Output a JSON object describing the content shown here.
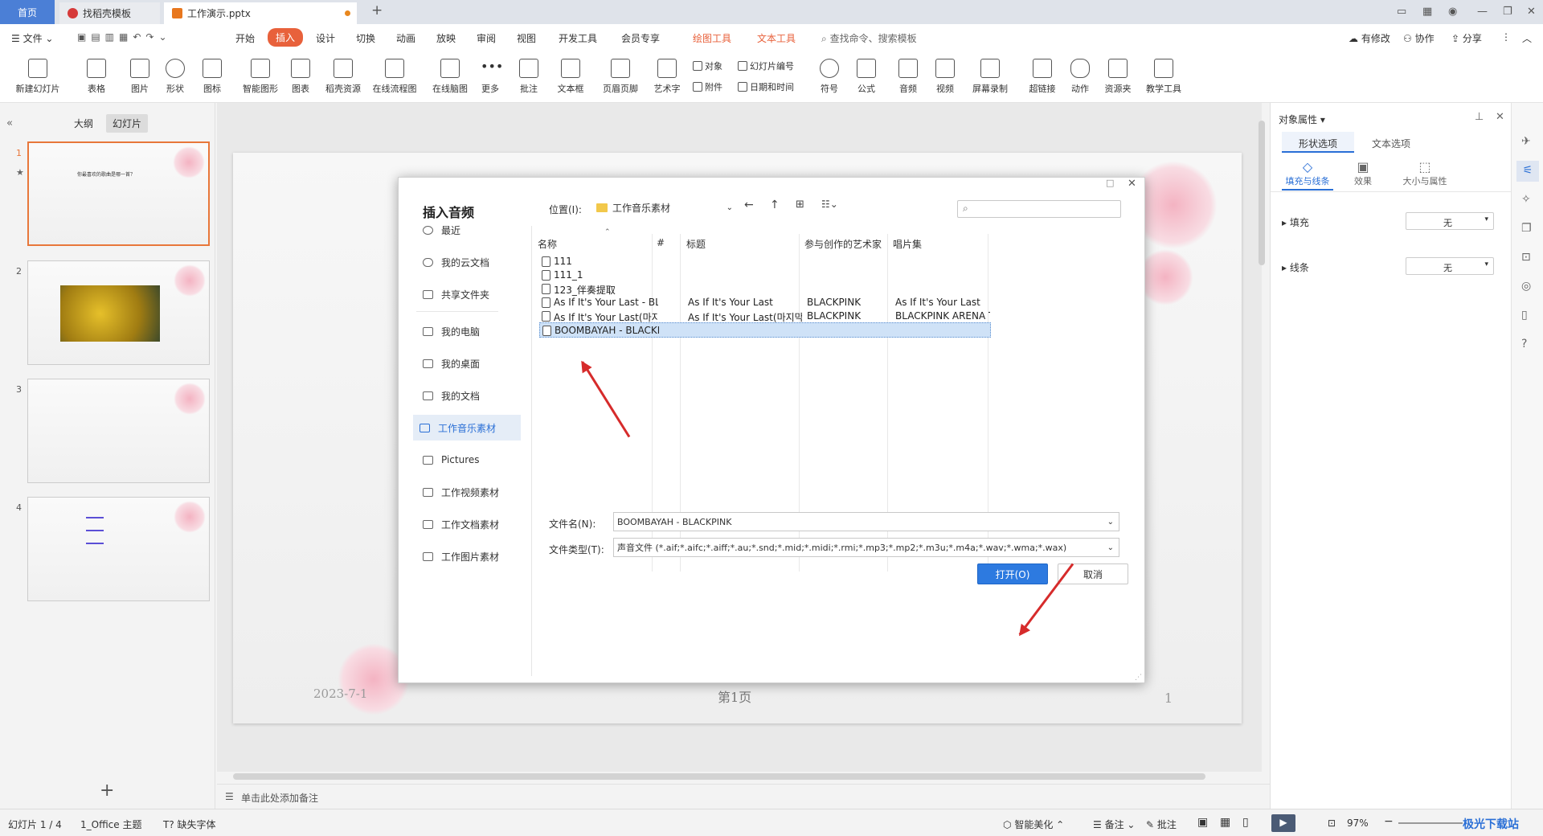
{
  "tabs": {
    "home": "首页",
    "template": "找稻壳模板",
    "doc": "工作演示.pptx"
  },
  "menubar": {
    "file": "文件",
    "items": [
      "开始",
      "插入",
      "设计",
      "切换",
      "动画",
      "放映",
      "审阅",
      "视图",
      "开发工具",
      "会员专享"
    ],
    "context_tools": [
      "绘图工具",
      "文本工具"
    ],
    "search": "查找命令、搜索模板",
    "right": [
      "有修改",
      "协作",
      "分享"
    ]
  },
  "ribbon": {
    "buttons": [
      "新建幻灯片",
      "表格",
      "图片",
      "形状",
      "图标",
      "智能图形",
      "图表",
      "稻壳资源",
      "在线流程图",
      "在线脑图",
      "更多",
      "批注",
      "文本框",
      "页眉页脚",
      "艺术字",
      "音频",
      "视频",
      "屏幕录制",
      "超链接",
      "动作",
      "资源夹",
      "教学工具"
    ],
    "small": [
      "对象",
      "幻灯片编号",
      "附件",
      "日期和时间",
      "符号",
      "公式"
    ]
  },
  "left_panel": {
    "tabs": [
      "大纲",
      "幻灯片"
    ],
    "slide_numbers": [
      "1",
      "2",
      "3",
      "4"
    ],
    "slide1_title": "你最喜欢的歌曲是哪一首？",
    "add": "+"
  },
  "slide": {
    "date": "2023-7-1",
    "footer": "第1页",
    "page_num": "1"
  },
  "right_panel": {
    "title": "对象属性",
    "tabs": [
      "形状选项",
      "文本选项"
    ],
    "subtabs": [
      "填充与线条",
      "效果",
      "大小与属性"
    ],
    "fill_label": "填充",
    "fill_value": "无",
    "line_label": "线条",
    "line_value": "无"
  },
  "dialog": {
    "title": "插入音频",
    "location_label": "位置(I):",
    "location_value": "工作音乐素材",
    "nav": [
      "最近",
      "我的云文档",
      "共享文件夹",
      "我的电脑",
      "我的桌面",
      "我的文档",
      "工作音乐素材",
      "Pictures",
      "工作视频素材",
      "工作文档素材",
      "工作图片素材"
    ],
    "columns": [
      "名称",
      "#",
      "标题",
      "参与创作的艺术家",
      "唱片集"
    ],
    "files": [
      {
        "name": "111",
        "title": "",
        "artist": "",
        "album": ""
      },
      {
        "name": "111_1",
        "title": "",
        "artist": "",
        "album": ""
      },
      {
        "name": "123_伴奏提取",
        "title": "",
        "artist": "",
        "album": ""
      },
      {
        "name": "As If It's Your Last - BLA...",
        "title": "As If It's Your Last",
        "artist": "BLACKPINK",
        "album": "As If It's Your Last"
      },
      {
        "name": "As If It's Your Last(마지...",
        "title": "As If It's Your Last(마지막처...",
        "artist": "BLACKPINK",
        "album": "BLACKPINK ARENA T..."
      },
      {
        "name": "BOOMBAYAH - BLACKP...",
        "title": "",
        "artist": "",
        "album": ""
      }
    ],
    "filename_label": "文件名(N):",
    "filename_value": "BOOMBAYAH - BLACKPINK",
    "filetype_label": "文件类型(T):",
    "filetype_value": "声音文件 (*.aif;*.aifc;*.aiff;*.au;*.snd;*.mid;*.midi;*.rmi;*.mp3;*.mp2;*.m3u;*.m4a;*.wav;*.wma;*.wax)",
    "open": "打开(O)",
    "cancel": "取消"
  },
  "notes": "单击此处添加备注",
  "status": {
    "slide": "幻灯片 1 / 4",
    "theme": "1_Office 主题",
    "font": "缺失字体",
    "beautify": "智能美化",
    "notes": "备注",
    "comment": "批注",
    "zoom": "97%"
  },
  "watermark": "极光下载站"
}
